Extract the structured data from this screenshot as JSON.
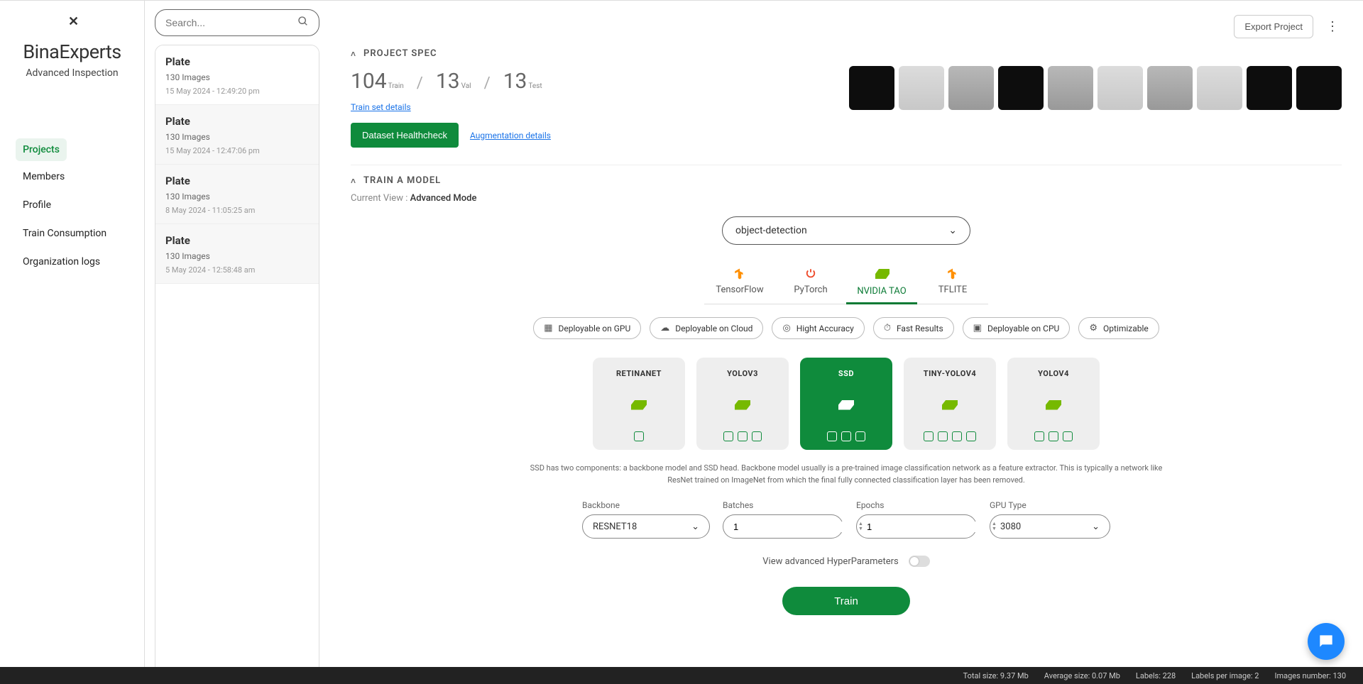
{
  "brand": {
    "name": "BinaExperts",
    "tagline": "Advanced Inspection"
  },
  "nav": {
    "items": [
      "Projects",
      "Members",
      "Profile",
      "Train Consumption",
      "Organization logs"
    ],
    "active_index": 0
  },
  "search": {
    "placeholder": "Search..."
  },
  "projects": [
    {
      "title": "Plate",
      "meta": "130 Images",
      "date": "15 May 2024 - 12:49:20 pm",
      "selected": true
    },
    {
      "title": "Plate",
      "meta": "130 Images",
      "date": "15 May 2024 - 12:47:06 pm",
      "selected": false
    },
    {
      "title": "Plate",
      "meta": "130 Images",
      "date": "8 May 2024 - 11:05:25 am",
      "selected": false
    },
    {
      "title": "Plate",
      "meta": "130 Images",
      "date": "5 May 2024 - 12:58:48 am",
      "selected": false
    }
  ],
  "topbar": {
    "export": "Export Project"
  },
  "section1": {
    "label": "PROJECT SPEC",
    "train": "104",
    "train_sub": "Train",
    "val": "13",
    "val_sub": "Val",
    "test": "13",
    "test_sub": "Test",
    "details_link": "Train set details",
    "healthcheck": "Dataset Healthcheck",
    "aug_link": "Augmentation details"
  },
  "section2": {
    "label": "TRAIN A MODEL",
    "curview_label": "Current View :",
    "curview_value": "Advanced Mode"
  },
  "task_select": {
    "value": "object-detection"
  },
  "frameworks": [
    {
      "name": "TensorFlow",
      "icon": "tf"
    },
    {
      "name": "PyTorch",
      "icon": "pt"
    },
    {
      "name": "NVIDIA TAO",
      "icon": "nv",
      "active": true
    },
    {
      "name": "TFLITE",
      "icon": "tf"
    }
  ],
  "chips": [
    {
      "label": "Deployable on GPU",
      "icon": "gpu"
    },
    {
      "label": "Deployable on Cloud",
      "icon": "cloud"
    },
    {
      "label": "Hight Accuracy",
      "icon": "target"
    },
    {
      "label": "Fast Results",
      "icon": "speed"
    },
    {
      "label": "Deployable on CPU",
      "icon": "cpu"
    },
    {
      "label": "Optimizable",
      "icon": "tune"
    }
  ],
  "models": [
    {
      "name": "RETINANET",
      "badges": 1
    },
    {
      "name": "YOLOV3",
      "badges": 3
    },
    {
      "name": "SSD",
      "badges": 3,
      "active": true
    },
    {
      "name": "TINY-YOLOV4",
      "badges": 4
    },
    {
      "name": "YOLOV4",
      "badges": 3
    }
  ],
  "model_desc": "SSD has two components: a backbone model and SSD head. Backbone model usually is a pre-trained image classification network as a feature extractor. This is typically a network like ResNet trained on ImageNet from which the final fully connected classification layer has been removed.",
  "params": {
    "backbone": {
      "label": "Backbone",
      "value": "RESNET18"
    },
    "batches": {
      "label": "Batches",
      "value": "1"
    },
    "epochs": {
      "label": "Epochs",
      "value": "1"
    },
    "gpu": {
      "label": "GPU Type",
      "value": "3080"
    }
  },
  "advanced_label": "View advanced HyperParameters",
  "train_btn": "Train",
  "footer": {
    "total_size": "Total size: 9.37 Mb",
    "avg_size": "Average size: 0.07 Mb",
    "labels": "Labels: 228",
    "lpi": "Labels per image: 2",
    "images": "Images number: 130"
  }
}
